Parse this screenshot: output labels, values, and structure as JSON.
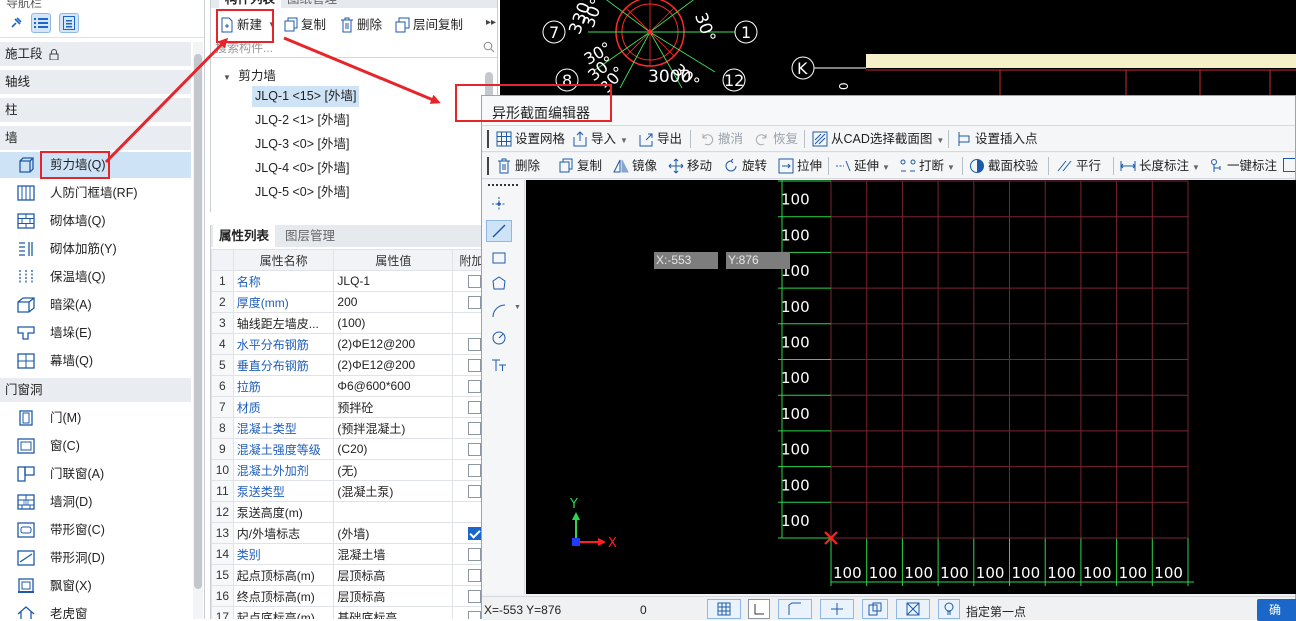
{
  "navigator": {
    "title": "导航栏",
    "categories": {
      "segment": "施工段",
      "axis": "轴线",
      "column": "柱",
      "wall": "墙",
      "opening": "门窗洞"
    },
    "wall_items": [
      {
        "label": "剪力墙(Q)",
        "icon": "shear-wall-icon"
      },
      {
        "label": "人防门框墙(RF)",
        "icon": "civil-defense-door-frame-icon"
      },
      {
        "label": "砌体墙(Q)",
        "icon": "masonry-wall-icon"
      },
      {
        "label": "砌体加筋(Y)",
        "icon": "masonry-reinforcement-icon"
      },
      {
        "label": "保温墙(Q)",
        "icon": "insulation-wall-icon"
      },
      {
        "label": "暗梁(A)",
        "icon": "hidden-beam-icon"
      },
      {
        "label": "墙垛(E)",
        "icon": "wall-buttress-icon"
      },
      {
        "label": "幕墙(Q)",
        "icon": "curtain-wall-icon"
      }
    ],
    "opening_items": [
      {
        "label": "门(M)",
        "icon": "door-icon"
      },
      {
        "label": "窗(C)",
        "icon": "window-icon"
      },
      {
        "label": "门联窗(A)",
        "icon": "door-window-icon"
      },
      {
        "label": "墙洞(D)",
        "icon": "wall-hole-icon"
      },
      {
        "label": "带形窗(C)",
        "icon": "strip-window-icon"
      },
      {
        "label": "带形洞(D)",
        "icon": "strip-hole-icon"
      },
      {
        "label": "飘窗(X)",
        "icon": "bay-window-icon"
      },
      {
        "label": "老虎窗",
        "icon": "dormer-window-icon"
      }
    ]
  },
  "component_list": {
    "tab_active": "构件列表",
    "tab_inactive": "图纸管理",
    "toolbar": {
      "new": "新建",
      "copy": "复制",
      "delete": "删除",
      "floor_copy": "层间复制"
    },
    "search_placeholder": "搜索构件...",
    "tree_root": "剪力墙",
    "items": [
      "JLQ-1 <15> [外墙]",
      "JLQ-2 <1> [外墙]",
      "JLQ-3 <0> [外墙]",
      "JLQ-4 <0> [外墙]",
      "JLQ-5 <0> [外墙]"
    ]
  },
  "property_list": {
    "tab_active": "属性列表",
    "tab_inactive": "图层管理",
    "headers": {
      "name": "属性名称",
      "value": "属性值",
      "extra": "附加"
    },
    "rows": [
      {
        "no": "1",
        "name": "名称",
        "value": "JLQ-1"
      },
      {
        "no": "2",
        "name": "厚度(mm)",
        "value": "200"
      },
      {
        "no": "3",
        "name": "轴线距左墙皮...",
        "value": "(100)"
      },
      {
        "no": "4",
        "name": "水平分布钢筋",
        "value": "(2)ΦE12@200"
      },
      {
        "no": "5",
        "name": "垂直分布钢筋",
        "value": "(2)ΦE12@200"
      },
      {
        "no": "6",
        "name": "拉筋",
        "value": "Φ6@600*600"
      },
      {
        "no": "7",
        "name": "材质",
        "value": "预拌砼"
      },
      {
        "no": "8",
        "name": "混凝土类型",
        "value": "(预拌混凝土)"
      },
      {
        "no": "9",
        "name": "混凝土强度等级",
        "value": "(C20)"
      },
      {
        "no": "10",
        "name": "混凝土外加剂",
        "value": "(无)"
      },
      {
        "no": "11",
        "name": "泵送类型",
        "value": "(混凝土泵)"
      },
      {
        "no": "12",
        "name": "泵送高度(m)",
        "value": ""
      },
      {
        "no": "13",
        "name": "内/外墙标志",
        "value": "(外墙)"
      },
      {
        "no": "14",
        "name": "类别",
        "value": "混凝土墙"
      },
      {
        "no": "15",
        "name": "起点顶标高(m)",
        "value": "层顶标高"
      },
      {
        "no": "16",
        "name": "终点顶标高(m)",
        "value": "层顶标高"
      },
      {
        "no": "17",
        "name": "起点底标高(m)",
        "value": "基础底标高"
      }
    ]
  },
  "cad": {
    "angle_labels": [
      "330°",
      "30°",
      "30°",
      "30°",
      "30°",
      "30°",
      "30°"
    ],
    "axis_numbers": [
      "7",
      "1",
      "8",
      "12"
    ],
    "bottom_text": "3000",
    "axis_letter": "K",
    "small_text": "0"
  },
  "editor": {
    "title": "异形截面编辑器",
    "toolbar1": {
      "grid": "设置网格",
      "import": "导入",
      "export": "导出",
      "undo": "撤消",
      "redo": "恢复",
      "from_cad": "从CAD选择截面图",
      "insert_point": "设置插入点"
    },
    "toolbar2": {
      "delete": "删除",
      "copy": "复制",
      "mirror": "镜像",
      "move": "移动",
      "rotate": "旋转",
      "stretch": "拉伸",
      "extend": "延伸",
      "break": "打断",
      "check": "截面校验",
      "parallel": "平行",
      "length_dim": "长度标注",
      "auto_dim": "一键标注"
    },
    "grid": {
      "row_labels": [
        "100",
        "100",
        "100",
        "100",
        "100",
        "100",
        "100",
        "100",
        "100",
        "100"
      ],
      "col_labels": [
        "100",
        "100",
        "100",
        "100",
        "100",
        "100",
        "100",
        "100",
        "100",
        "100"
      ]
    },
    "coord_x": "X:-553",
    "coord_y": "Y:876",
    "axis_x": "X",
    "axis_y": "Y",
    "status": {
      "coords": "X=-553 Y=876",
      "angle": "0",
      "prompt": "指定第一点",
      "confirm": "确"
    }
  },
  "colors": {
    "accent": "#1a66c9",
    "annotation": "#e8242b",
    "grid_line": "#7a2430",
    "axis_line": "#2bd64a"
  }
}
